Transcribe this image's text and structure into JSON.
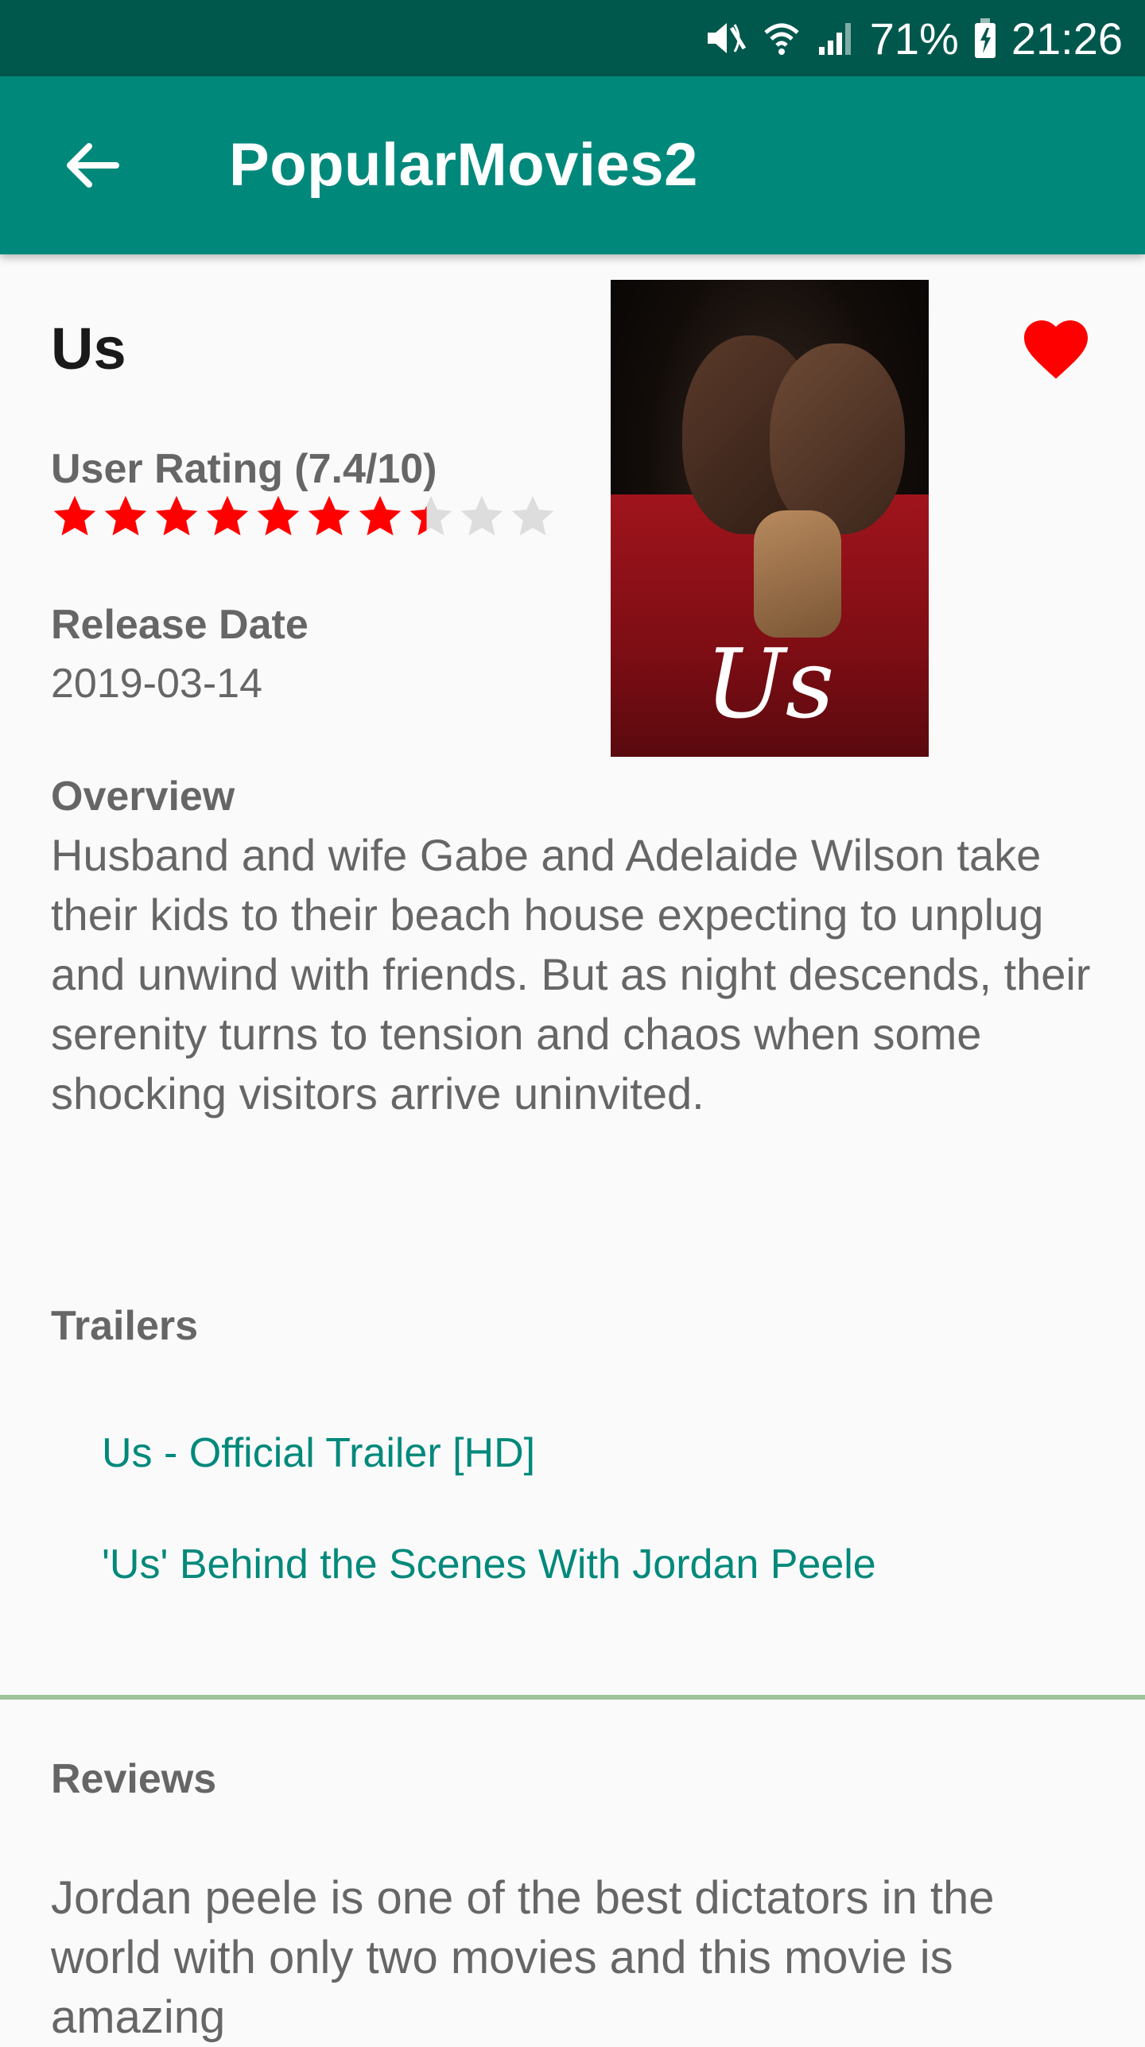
{
  "status_bar": {
    "battery": "71%",
    "time": "21:26"
  },
  "app_bar": {
    "title": "PopularMovies2"
  },
  "movie": {
    "title": "Us",
    "rating_label": "User Rating (7.4/10)",
    "rating": 7.4,
    "rating_max": 10,
    "release_label": "Release Date",
    "release_date": "2019-03-14",
    "poster_text": "Us",
    "favorite": true,
    "overview_label": "Overview",
    "overview": "Husband and wife Gabe and Adelaide Wilson take their kids to their beach house expecting to unplug and unwind with friends. But as night descends, their serenity turns to tension and chaos when some shocking visitors arrive uninvited."
  },
  "trailers": {
    "label": "Trailers",
    "items": [
      {
        "title": "Us - Official Trailer [HD]"
      },
      {
        "title": "'Us' Behind the Scenes With Jordan Peele"
      }
    ]
  },
  "reviews": {
    "label": "Reviews",
    "items": [
      {
        "text": "Jordan peele is one of the best dictators in the world with only two movies and this movie is amazing"
      }
    ]
  },
  "colors": {
    "status_bar": "#00584d",
    "app_bar": "#00897b",
    "accent_link": "#00897b",
    "star_filled": "#ff0000",
    "star_empty": "#dddddd",
    "heart": "#ff0000",
    "divider": "#9dc49a"
  }
}
